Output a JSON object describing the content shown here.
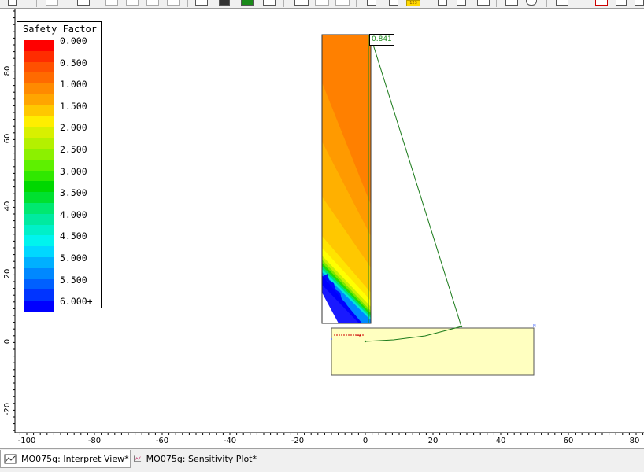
{
  "legend": {
    "title": "Safety Factor",
    "entries": [
      {
        "label": "0.000",
        "colors": [
          "#ff0000",
          "#ff2c00"
        ]
      },
      {
        "label": "0.500",
        "colors": [
          "#ff5000",
          "#ff6a00"
        ]
      },
      {
        "label": "1.000",
        "colors": [
          "#ff8a00",
          "#ffa500"
        ]
      },
      {
        "label": "1.500",
        "colors": [
          "#ffc800",
          "#ffee00"
        ]
      },
      {
        "label": "2.000",
        "colors": [
          "#d8f000",
          "#b4f000"
        ]
      },
      {
        "label": "2.500",
        "colors": [
          "#8cf000",
          "#5ef000"
        ]
      },
      {
        "label": "3.000",
        "colors": [
          "#30e800",
          "#00d800"
        ]
      },
      {
        "label": "3.500",
        "colors": [
          "#00e030",
          "#00e870"
        ]
      },
      {
        "label": "4.000",
        "colors": [
          "#00eaa0",
          "#00f0c8"
        ]
      },
      {
        "label": "4.500",
        "colors": [
          "#00f4ee",
          "#00d8ff"
        ]
      },
      {
        "label": "5.000",
        "colors": [
          "#00b0ff",
          "#0088ff"
        ]
      },
      {
        "label": "5.500",
        "colors": [
          "#0060ff",
          "#0034ff"
        ]
      },
      {
        "label": "6.000+",
        "colors": [
          "#0000ff"
        ]
      }
    ]
  },
  "axes": {
    "x_ticks": [
      "-100",
      "-80",
      "-60",
      "-40",
      "-20",
      "0",
      "20",
      "40",
      "60",
      "80"
    ],
    "y_ticks": [
      "80",
      "60",
      "40",
      "20",
      "0",
      "-20"
    ]
  },
  "model": {
    "critical_factor_label": "0.841",
    "point_label": "N",
    "load_label": "→"
  },
  "tabs": [
    {
      "label": "MO075g: Interpret View*",
      "active": true
    },
    {
      "label": "MO075g: Sensitivity Plot*",
      "active": false
    }
  ],
  "toolbar": {
    "badge": "123"
  }
}
